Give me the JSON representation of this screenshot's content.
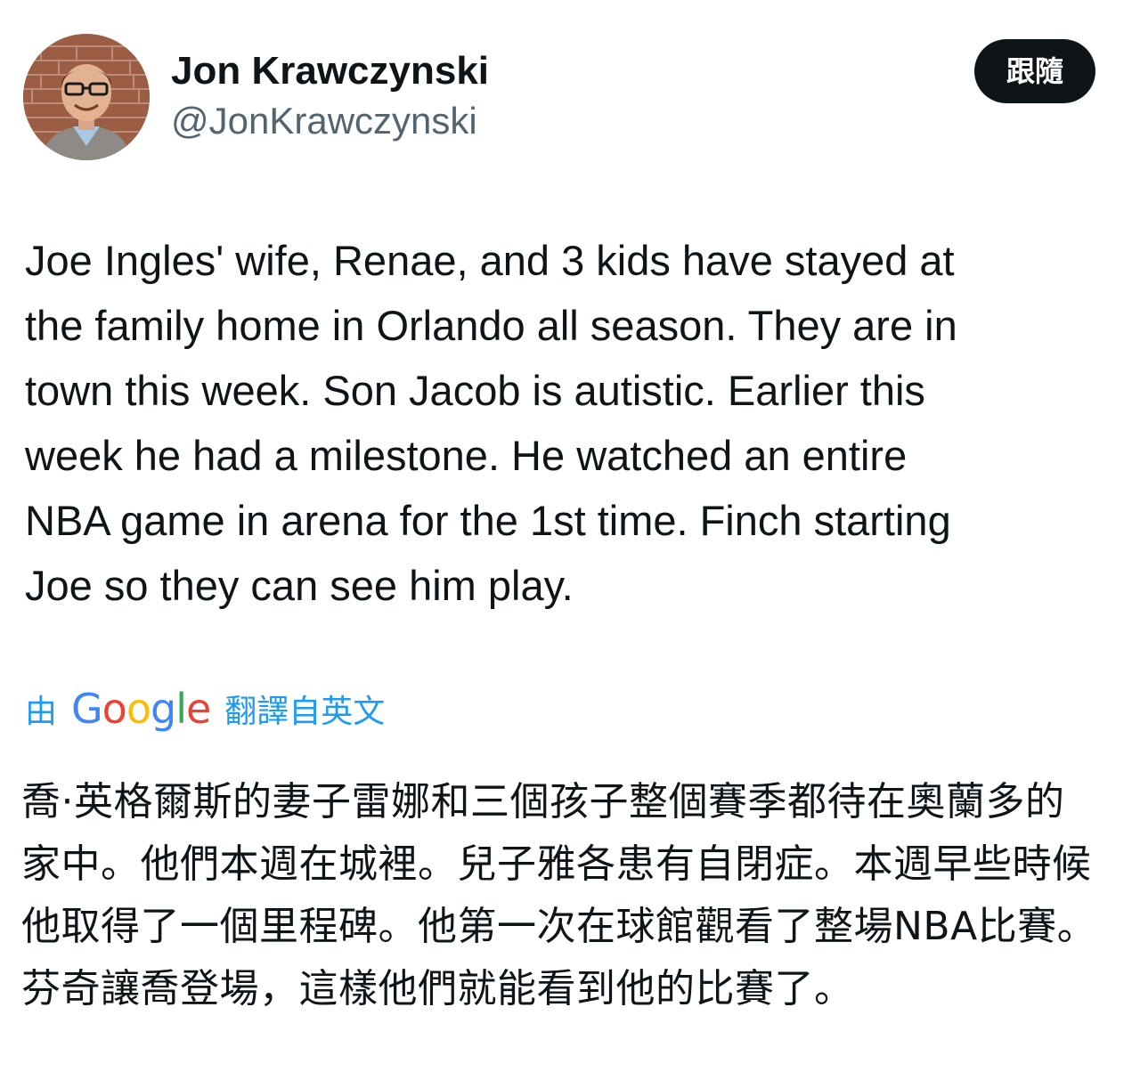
{
  "author": {
    "display_name": "Jon Krawczynski",
    "handle": "@JonKrawczynski",
    "avatar_icon": "profile-photo"
  },
  "follow_button_label": "跟隨",
  "tweet": {
    "text": "Joe Ingles' wife, Renae, and 3 kids have stayed at\nthe family home in Orlando all season. They are in\ntown this week. Son Jacob is autistic. Earlier this\nweek he had a milestone. He watched an entire\nNBA game in arena for the 1st time. Finch starting\nJoe so they can see him play."
  },
  "translation": {
    "by_label": "由",
    "provider_letters": [
      "G",
      "o",
      "o",
      "g",
      "l",
      "e"
    ],
    "label": "翻譯自英文",
    "text": "喬·英格爾斯的妻子雷娜和三個孩子整個賽季都待在奧蘭多的家中。他們本週在城裡。兒子雅各患有自閉症。本週早些時候他取得了一個里程碑。他第一次在球館觀看了整場NBA比賽。芬奇讓喬登場，這樣他們就能看到他的比賽了。"
  },
  "colors": {
    "link_blue": "#1d9bf0",
    "secondary_text": "#536471",
    "primary_text": "#0f1419",
    "google_blue": "#4285f4",
    "google_red": "#ea4335",
    "google_yellow": "#fbbc05",
    "google_green": "#34a853"
  }
}
